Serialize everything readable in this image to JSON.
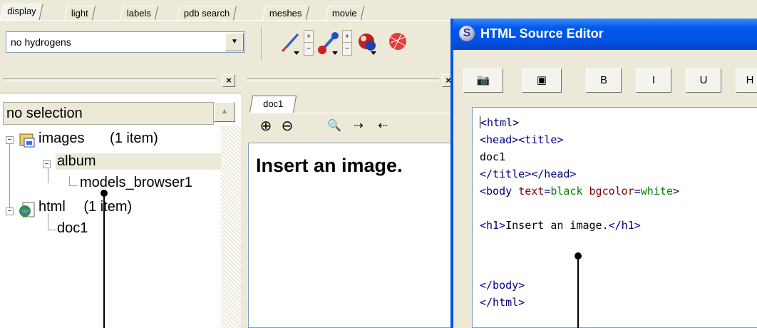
{
  "tabs": [
    "display",
    "light",
    "labels",
    "pdb search",
    "meshes",
    "movie"
  ],
  "toolbar": {
    "hydrogen_select": "no hydrogens"
  },
  "left_pane": {
    "selection_label": "no selection",
    "tree": {
      "images_label": "images",
      "images_count": "(1 item)",
      "album_label": "album",
      "models_label": "models_browser1",
      "html_label": "html",
      "html_count": "(1 item)",
      "doc_label": "doc1"
    }
  },
  "doc_pane": {
    "tab_label": "doc1",
    "heading": "Insert an image."
  },
  "editor": {
    "title": "HTML Source Editor",
    "buttons": [
      "B",
      "I",
      "U",
      "H"
    ],
    "code": {
      "l1": "<html>",
      "l2a": "<head>",
      "l2b": "<title>",
      "l3": "doc1",
      "l4a": "</title>",
      "l4b": "</head>",
      "l5_tag_open": "<body ",
      "l5_a1": "text",
      "l5_eq1": "=",
      "l5_v1": "black",
      "l5_a2": " bgcolor",
      "l5_eq2": "=",
      "l5_v2": "white",
      "l5_close": ">",
      "l6_open": "<h1>",
      "l6_text": "Insert an image.",
      "l6_close": "</h1>",
      "l7": "</body>",
      "l8": "</html>"
    }
  },
  "colors": {
    "title_blue": "#0054e3",
    "tag": "#000080",
    "attr": "#800000",
    "value": "#008000"
  }
}
